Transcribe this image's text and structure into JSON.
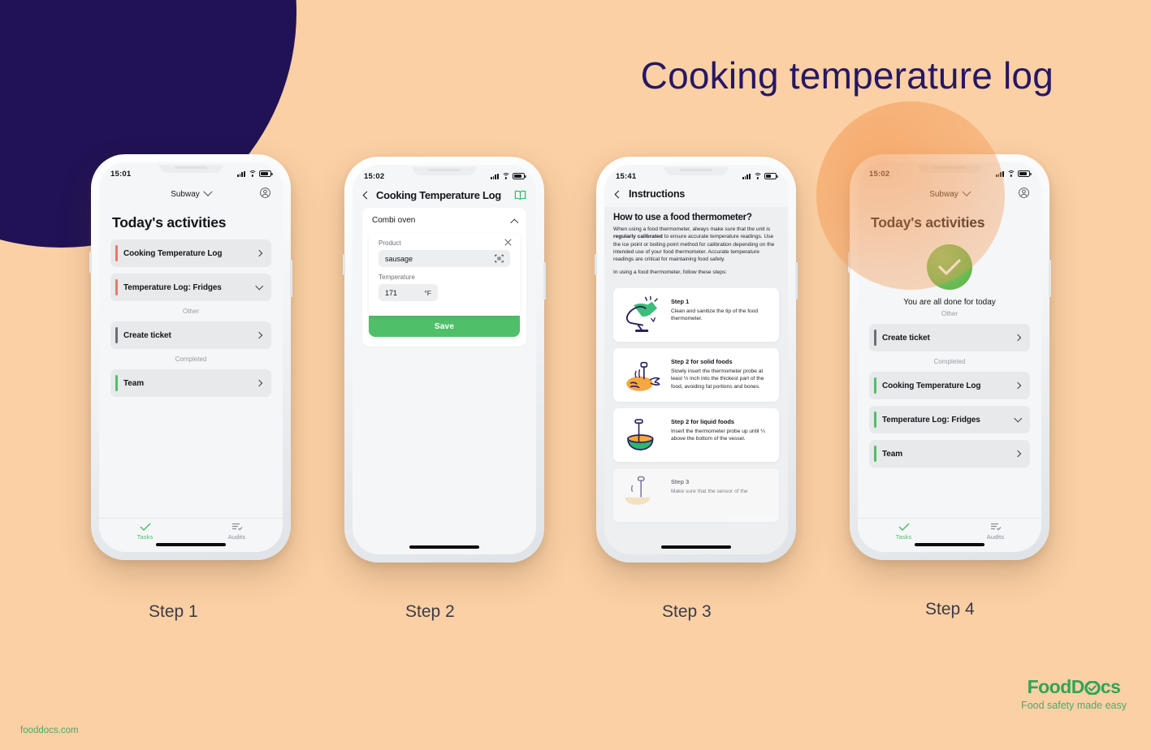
{
  "headline": "Cooking temperature log",
  "colors": {
    "background": "#FBD0A4",
    "navy": "#201255",
    "brand_green": "#30A556",
    "accent_green": "#4FBF6A",
    "red_bar": "#F2736E",
    "gray_bar": "#6E6E78"
  },
  "steps": [
    {
      "caption": "Step 1"
    },
    {
      "caption": "Step 2"
    },
    {
      "caption": "Step 3"
    },
    {
      "caption": "Step 4"
    }
  ],
  "phone1": {
    "status": {
      "time": "15:01"
    },
    "org": "Subway",
    "page_title": "Today's activities",
    "rows": [
      {
        "label": "Cooking Temperature Log",
        "bar": "red",
        "chevron": "right"
      },
      {
        "label": "Temperature Log: Fridges",
        "bar": "red",
        "chevron": "down"
      }
    ],
    "group_other": "Other",
    "other_rows": [
      {
        "label": "Create ticket",
        "bar": "gray",
        "chevron": "right"
      }
    ],
    "group_completed": "Completed",
    "completed_rows": [
      {
        "label": "Team",
        "bar": "green",
        "chevron": "right"
      }
    ],
    "tabs": [
      {
        "label": "Tasks",
        "active": true
      },
      {
        "label": "Audits",
        "active": false
      }
    ]
  },
  "phone2": {
    "status": {
      "time": "15:02"
    },
    "nav_title": "Cooking Temperature Log",
    "section_title": "Combi oven",
    "form": {
      "product_label": "Product",
      "product_value": "sausage",
      "temperature_label": "Temperature",
      "temperature_value": "171",
      "temperature_unit": "°F",
      "save_label": "Save"
    }
  },
  "phone3": {
    "status": {
      "time": "15:41"
    },
    "nav_title": "Instructions",
    "heading": "How to use a food thermometer?",
    "paragraph1_a": "When using a food thermometer, always make sure that the unit is ",
    "paragraph1_b": "regularly calibrated",
    "paragraph1_c": " to ensure accurate temperature readings. Use the ice point or boiling point method for calibration depending on the intended use of your food thermometer. Accurate temperature readings are critical for maintaining food safety.",
    "paragraph2": "In using a food thermometer, follow these steps:",
    "cards": [
      {
        "title": "Step 1",
        "desc": "Clean and sanitize the tip of the food thermometer.",
        "illustration": "hand-wiping-thermometer-icon"
      },
      {
        "title": "Step 2 for solid foods",
        "desc": "Slowly insert the thermometer probe at least ½ inch into the thickest part of the food, avoiding fat portions and bones.",
        "illustration": "roast-chicken-probe-icon"
      },
      {
        "title": "Step 2 for liquid foods",
        "desc": "Insert the thermometer probe up until ¼ above the bottom of the vessel.",
        "illustration": "soup-bowl-probe-icon"
      },
      {
        "title": "Step 3",
        "desc": "Make sure that the sensor of the",
        "illustration": "food-probe-icon"
      }
    ]
  },
  "phone4": {
    "status": {
      "time": "15:02"
    },
    "org": "Subway",
    "page_title": "Today's activities",
    "done_message": "You are all done for today",
    "group_other": "Other",
    "other_rows": [
      {
        "label": "Create ticket",
        "bar": "gray",
        "chevron": "right"
      }
    ],
    "group_completed": "Completed",
    "completed_rows": [
      {
        "label": "Cooking Temperature Log",
        "bar": "green",
        "chevron": "right"
      },
      {
        "label": "Temperature Log: Fridges",
        "bar": "green",
        "chevron": "down"
      },
      {
        "label": "Team",
        "bar": "green",
        "chevron": "right"
      }
    ],
    "tabs": [
      {
        "label": "Tasks",
        "active": true
      },
      {
        "label": "Audits",
        "active": false
      }
    ]
  },
  "footer": {
    "url": "fooddocs.com",
    "brand_part1": "FoodD",
    "brand_part2": "cs",
    "tagline": "Food safety made easy"
  }
}
